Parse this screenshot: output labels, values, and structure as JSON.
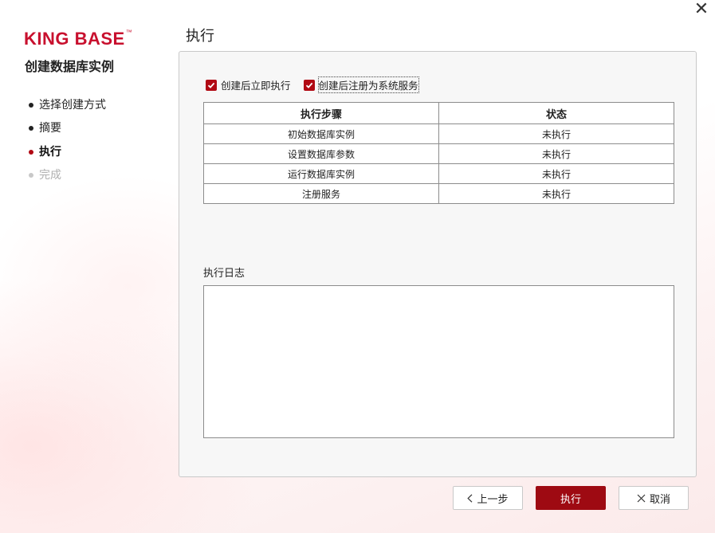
{
  "window": {
    "close_icon": "close-icon"
  },
  "brand": {
    "logo_text": "KING BASE",
    "logo_tm": "™",
    "color": "#c8102e"
  },
  "wizard": {
    "title": "创建数据库实例",
    "steps": [
      {
        "label": "选择创建方式",
        "state": "done"
      },
      {
        "label": "摘要",
        "state": "done"
      },
      {
        "label": "执行",
        "state": "active"
      },
      {
        "label": "完成",
        "state": "todo"
      }
    ]
  },
  "page": {
    "title": "执行"
  },
  "options": {
    "run_after_create": {
      "label": "创建后立即执行",
      "checked": true
    },
    "register_service": {
      "label": "创建后注册为系统服务",
      "checked": true
    }
  },
  "steps_table": {
    "headers": [
      "执行步骤",
      "状态"
    ],
    "rows": [
      [
        "初始数据库实例",
        "未执行"
      ],
      [
        "设置数据库参数",
        "未执行"
      ],
      [
        "运行数据库实例",
        "未执行"
      ],
      [
        "注册服务",
        "未执行"
      ]
    ]
  },
  "log": {
    "label": "执行日志",
    "value": ""
  },
  "buttons": {
    "prev": "上一步",
    "run": "执行",
    "cancel": "取消"
  },
  "colors": {
    "accent": "#9e0a12",
    "active_dot": "#b10a14"
  }
}
